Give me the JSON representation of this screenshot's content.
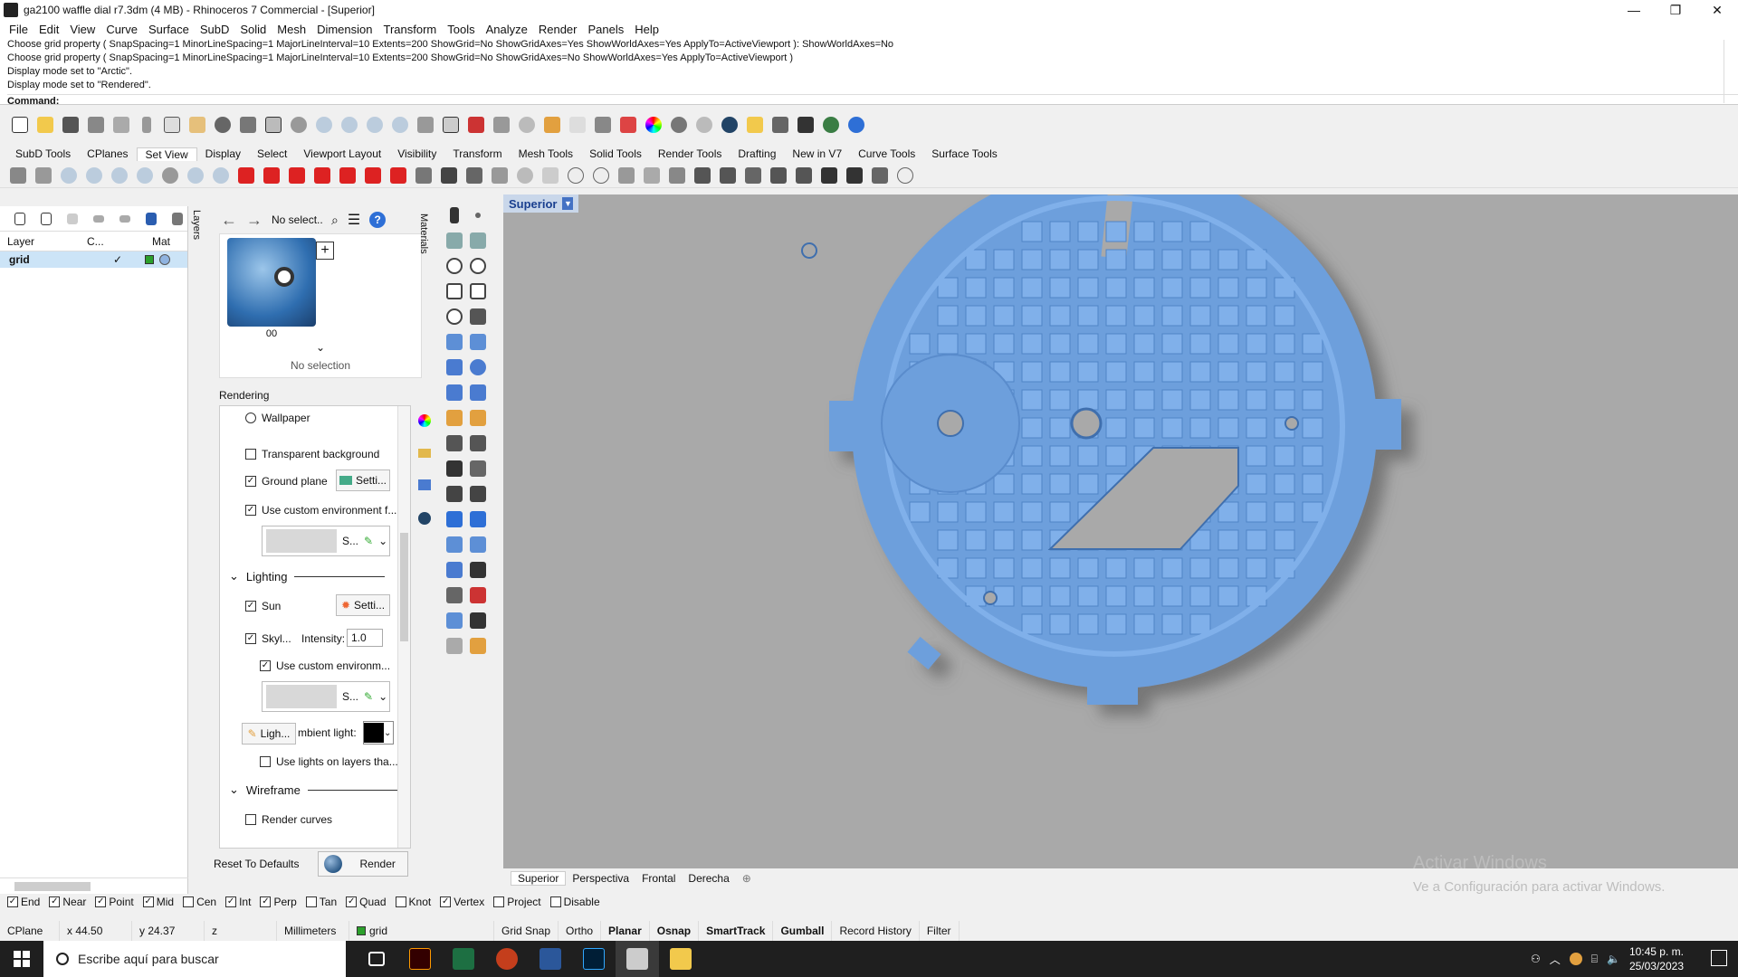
{
  "window": {
    "title": "ga2100 waffle dial r7.3dm (4 MB) - Rhinoceros 7 Commercial - [Superior]",
    "minimize": "—",
    "restore": "❐",
    "close": "✕"
  },
  "menu": [
    "File",
    "Edit",
    "View",
    "Curve",
    "Surface",
    "SubD",
    "Solid",
    "Mesh",
    "Dimension",
    "Transform",
    "Tools",
    "Analyze",
    "Render",
    "Panels",
    "Help"
  ],
  "command": {
    "history": [
      "Choose grid property ( SnapSpacing=1  MinorLineSpacing=1  MajorLineInterval=10  Extents=200  ShowGrid=No  ShowGridAxes=Yes  ShowWorldAxes=Yes  ApplyTo=ActiveViewport ): ShowWorldAxes=No",
      "Choose grid property ( SnapSpacing=1  MinorLineSpacing=1  MajorLineInterval=10  Extents=200  ShowGrid=No  ShowGridAxes=No  ShowWorldAxes=Yes  ApplyTo=ActiveViewport )",
      "Display mode set to \"Arctic\".",
      "Display mode set to \"Rendered\"."
    ],
    "prompt": "Command:"
  },
  "tabs": [
    "SubD Tools",
    "CPlanes",
    "Set View",
    "Display",
    "Select",
    "Viewport Layout",
    "Visibility",
    "Transform",
    "Mesh Tools",
    "Solid Tools",
    "Render Tools",
    "Drafting",
    "New in V7",
    "Curve Tools",
    "Surface Tools"
  ],
  "layers": {
    "tab_label": "Layers",
    "col_layer": "Layer",
    "col_current": "C...",
    "col_material": "Mat",
    "rows": [
      {
        "name": "grid",
        "check": "✓"
      }
    ]
  },
  "materials": {
    "tab_label": "Materials",
    "select_value": "No select...",
    "swatch_label": "00",
    "no_selection": "No selection",
    "rendering_title": "Rendering",
    "opts": {
      "wallpaper": "Wallpaper",
      "transparent": "Transparent background",
      "ground": "Ground plane",
      "ground_settings": "Setti...",
      "custom_env": "Use custom environment f...",
      "env_short": "S...",
      "lighting": "Lighting",
      "sun": "Sun",
      "sun_settings": "Setti...",
      "skylight": "Skyl...",
      "intensity_label": "Intensity:",
      "intensity_value": "1.0",
      "custom_env2": "Use custom environm...",
      "env2_short": "S...",
      "lights": "Ligh...",
      "ambient": "mbient light:",
      "lights_layers": "Use lights on layers tha...",
      "wireframe": "Wireframe",
      "render_curves": "Render curves"
    },
    "reset": "Reset To Defaults",
    "render": "Render"
  },
  "viewport": {
    "name": "Superior",
    "drop": "▼",
    "watermark_title": "Activar Windows",
    "watermark_sub": "Ve a Configuración para activar Windows.",
    "tabs": [
      "Superior",
      "Perspectiva",
      "Frontal",
      "Derecha"
    ],
    "add_tab": "⊕"
  },
  "osnap": [
    {
      "label": "End",
      "checked": true
    },
    {
      "label": "Near",
      "checked": true
    },
    {
      "label": "Point",
      "checked": true
    },
    {
      "label": "Mid",
      "checked": true
    },
    {
      "label": "Cen",
      "checked": false
    },
    {
      "label": "Int",
      "checked": true
    },
    {
      "label": "Perp",
      "checked": true
    },
    {
      "label": "Tan",
      "checked": false
    },
    {
      "label": "Quad",
      "checked": true
    },
    {
      "label": "Knot",
      "checked": false
    },
    {
      "label": "Vertex",
      "checked": true
    },
    {
      "label": "Project",
      "checked": false
    },
    {
      "label": "Disable",
      "checked": false
    }
  ],
  "status": {
    "cplane": "CPlane",
    "x": "x 44.50",
    "y": "y 24.37",
    "z": "z",
    "units": "Millimeters",
    "layer": "grid",
    "toggles": [
      "Grid Snap",
      "Ortho",
      "Planar",
      "Osnap",
      "SmartTrack",
      "Gumball",
      "Record History",
      "Filter"
    ]
  },
  "taskbar": {
    "search": "Escribe aquí para buscar",
    "time": "10:45 p. m.",
    "date": "25/03/2023"
  },
  "colors": {
    "part": "#6d9fdc",
    "part_dark": "#4f84c6",
    "part_light": "#80b0ea",
    "viewport_bg": "#a9a9a9"
  }
}
